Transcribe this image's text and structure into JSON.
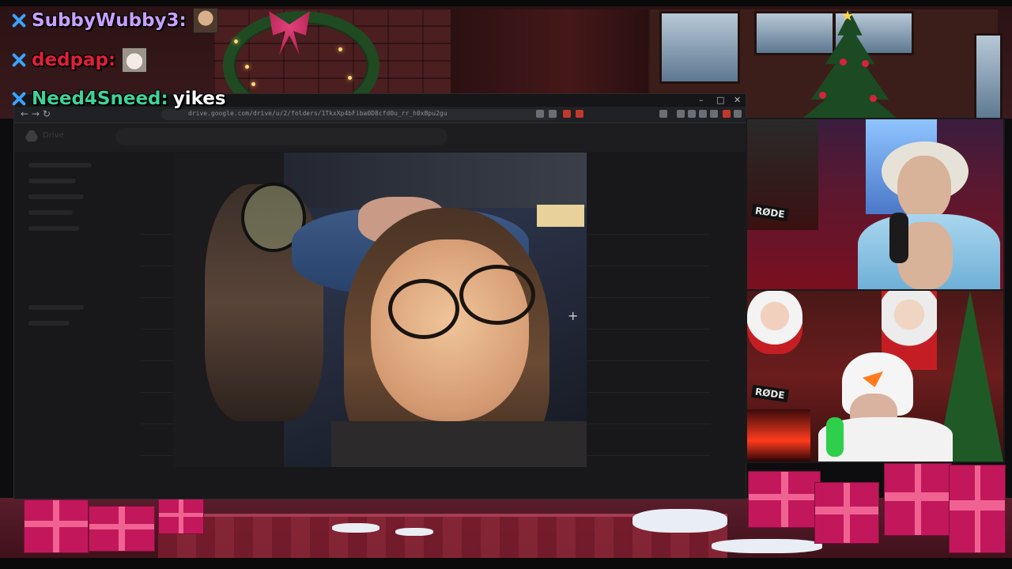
{
  "chat": {
    "messages": [
      {
        "username": "SubbyWubby3:",
        "name_color": "#c9a0ff",
        "text": "",
        "emote": "sunglasses-face-emote"
      },
      {
        "username": "dedpap:",
        "name_color": "#e0203a",
        "text": "",
        "emote": "cat-emote"
      },
      {
        "username": "Need4Sneed:",
        "name_color": "#3fd29a",
        "text": "yikes",
        "emote": ""
      }
    ],
    "badge_icon": "sword-badge-icon"
  },
  "browser": {
    "url": "drive.google.com/drive/u/2/folders/1TkxXp4bFiba0D8cfd0u_rr_h0xBpu2gu",
    "window_controls": {
      "minimize": "–",
      "maximize": "□",
      "close": "✕"
    },
    "nav": {
      "back": "←",
      "forward": "→",
      "reload": "↻"
    }
  },
  "drive": {
    "app_name": "Drive"
  },
  "viewer": {
    "cursor_icon": "crosshair-plus-icon",
    "cursor_glyph": "+"
  },
  "cams": {
    "top_mic_label": "RØDE",
    "bottom_mic_label": "RØDE"
  },
  "colors": {
    "accent_badge": "#3aa3ff",
    "gift_pink": "#c2185b"
  }
}
